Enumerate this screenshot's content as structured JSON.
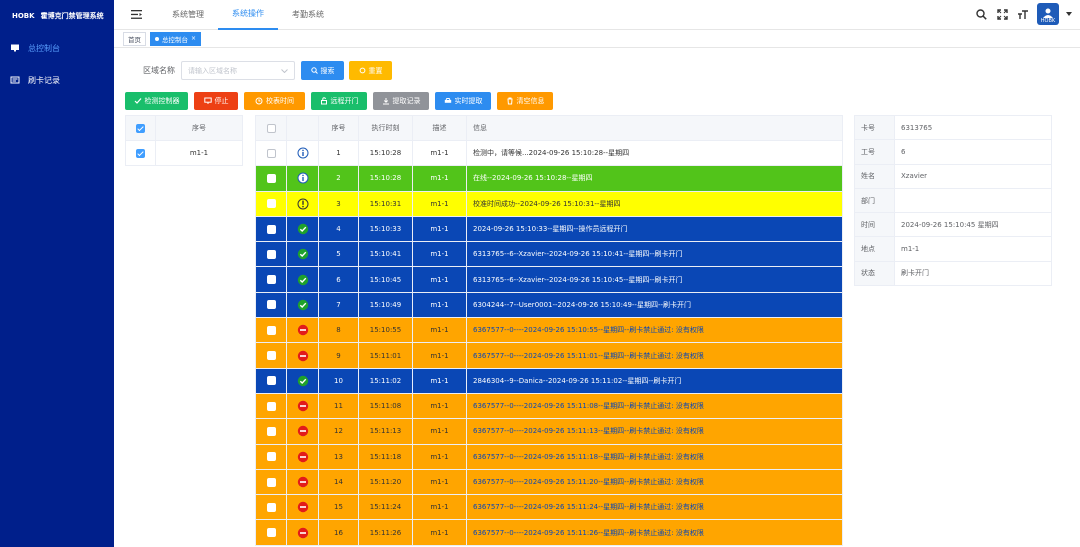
{
  "app": {
    "title": "HOBK",
    "subtitle": "霍博克门禁管理系统"
  },
  "sidebar": {
    "items": [
      {
        "label": "总控制台",
        "icon": "monitor-icon",
        "active": true
      },
      {
        "label": "刷卡记录",
        "icon": "card-icon",
        "active": false
      }
    ]
  },
  "topnav": {
    "tabs": [
      {
        "label": "系统管理",
        "active": false
      },
      {
        "label": "系统操作",
        "active": true
      },
      {
        "label": "考勤系统",
        "active": false
      }
    ],
    "avatar_text": "HOBK"
  },
  "tags": {
    "home": "首页",
    "current": "总控制台"
  },
  "filter": {
    "label": "区域名称",
    "placeholder": "请输入区域名称",
    "search": "搜索",
    "reset": "重置"
  },
  "toolbar": [
    {
      "label": "检测控制器",
      "color": "#19be6b",
      "icon": "check-icon"
    },
    {
      "label": "停止",
      "color": "#ed4014",
      "icon": "monitor-icon"
    },
    {
      "label": "校表时间",
      "color": "#ff9900",
      "icon": "clock-icon"
    },
    {
      "label": "远程开门",
      "color": "#19be6b",
      "icon": "unlock-icon"
    },
    {
      "label": "提取记录",
      "color": "#909399",
      "icon": "download-icon"
    },
    {
      "label": "实时提取",
      "color": "#2d8cf0",
      "icon": "car-icon"
    },
    {
      "label": "清空信息",
      "color": "#ff9900",
      "icon": "trash-icon"
    }
  ],
  "left_table": {
    "header": "序号",
    "rows": [
      {
        "name": "m1-1",
        "checked": true
      }
    ]
  },
  "main_table": {
    "headers": {
      "seq": "序号",
      "time": "执行时刻",
      "desc": "描述",
      "info": "信息"
    },
    "rows": [
      {
        "seq": "1",
        "time": "15:10:28",
        "desc": "m1-1",
        "info": "检测中，请等候...2024-09-26 15:10:28--星期四",
        "color": "white",
        "status": "info"
      },
      {
        "seq": "2",
        "time": "15:10:28",
        "desc": "m1-1",
        "info": "在线--2024-09-26 15:10:28--星期四",
        "color": "green",
        "status": "info"
      },
      {
        "seq": "3",
        "time": "15:10:31",
        "desc": "m1-1",
        "info": "校准时间成功--2024-09-26 15:10:31--星期四",
        "color": "yellow",
        "status": "warning"
      },
      {
        "seq": "4",
        "time": "15:10:33",
        "desc": "m1-1",
        "info": "2024-09-26 15:10:33--星期四--操作员远程开门",
        "color": "blue",
        "status": "success"
      },
      {
        "seq": "5",
        "time": "15:10:41",
        "desc": "m1-1",
        "info": "6313765--6--Xzavier--2024-09-26 15:10:41--星期四--刷卡开门",
        "color": "blue",
        "status": "success"
      },
      {
        "seq": "6",
        "time": "15:10:45",
        "desc": "m1-1",
        "info": "6313765--6--Xzavier--2024-09-26 15:10:45--星期四--刷卡开门",
        "color": "blue",
        "status": "success"
      },
      {
        "seq": "7",
        "time": "15:10:49",
        "desc": "m1-1",
        "info": "6304244--7--User0001--2024-09-26 15:10:49--星期四--刷卡开门",
        "color": "blue",
        "status": "success"
      },
      {
        "seq": "8",
        "time": "15:10:55",
        "desc": "m1-1",
        "info": "6367577--0----2024-09-26 15:10:55--星期四--刷卡禁止通过: 没有权限",
        "color": "orange",
        "status": "denied"
      },
      {
        "seq": "9",
        "time": "15:11:01",
        "desc": "m1-1",
        "info": "6367577--0----2024-09-26 15:11:01--星期四--刷卡禁止通过: 没有权限",
        "color": "orange",
        "status": "denied"
      },
      {
        "seq": "10",
        "time": "15:11:02",
        "desc": "m1-1",
        "info": "2846304--9--Danica--2024-09-26 15:11:02--星期四--刷卡开门",
        "color": "blue",
        "status": "success"
      },
      {
        "seq": "11",
        "time": "15:11:08",
        "desc": "m1-1",
        "info": "6367577--0----2024-09-26 15:11:08--星期四--刷卡禁止通过: 没有权限",
        "color": "orange",
        "status": "denied"
      },
      {
        "seq": "12",
        "time": "15:11:13",
        "desc": "m1-1",
        "info": "6367577--0----2024-09-26 15:11:13--星期四--刷卡禁止通过: 没有权限",
        "color": "orange",
        "status": "denied"
      },
      {
        "seq": "13",
        "time": "15:11:18",
        "desc": "m1-1",
        "info": "6367577--0----2024-09-26 15:11:18--星期四--刷卡禁止通过: 没有权限",
        "color": "orange",
        "status": "denied"
      },
      {
        "seq": "14",
        "time": "15:11:20",
        "desc": "m1-1",
        "info": "6367577--0----2024-09-26 15:11:20--星期四--刷卡禁止通过: 没有权限",
        "color": "orange",
        "status": "denied"
      },
      {
        "seq": "15",
        "time": "15:11:24",
        "desc": "m1-1",
        "info": "6367577--0----2024-09-26 15:11:24--星期四--刷卡禁止通过: 没有权限",
        "color": "orange",
        "status": "denied"
      },
      {
        "seq": "16",
        "time": "15:11:26",
        "desc": "m1-1",
        "info": "6367577--0----2024-09-26 15:11:26--星期四--刷卡禁止通过: 没有权限",
        "color": "orange",
        "status": "denied"
      }
    ]
  },
  "detail": [
    {
      "key": "卡号",
      "value": "6313765"
    },
    {
      "key": "工号",
      "value": "6"
    },
    {
      "key": "姓名",
      "value": "Xzavier"
    },
    {
      "key": "部门",
      "value": ""
    },
    {
      "key": "时间",
      "value": "2024-09-26 15:10:45 星期四"
    },
    {
      "key": "地点",
      "value": "m1-1"
    },
    {
      "key": "状态",
      "value": "刷卡开门"
    }
  ]
}
